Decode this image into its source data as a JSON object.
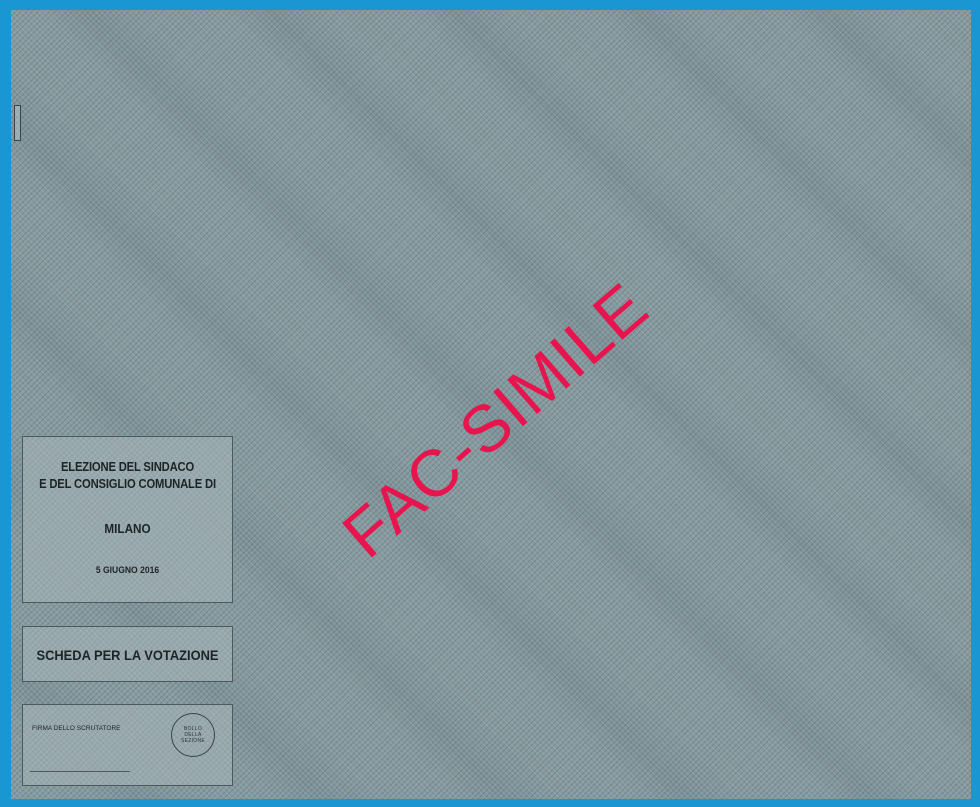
{
  "ballot": {
    "watermark": "FAC-SIMILE",
    "election": {
      "title_line1": "ELEZIONE DEL SINDACO",
      "title_line2": "E DEL CONSIGLIO COMUNALE DI",
      "city": "MILANO",
      "date": "5 GIUGNO 2016"
    },
    "ballot_label": "SCHEDA PER LA VOTAZIONE",
    "signature": {
      "scrutineer_label": "FIRMA DELLO SCRUTATORE",
      "seal_line1": "BOLLO",
      "seal_line2": "DELLA",
      "seal_line3": "SEZIONE"
    }
  },
  "colors": {
    "frame": "#1a96d2",
    "watermark": "#e8144e",
    "paper": "#8b999d"
  }
}
